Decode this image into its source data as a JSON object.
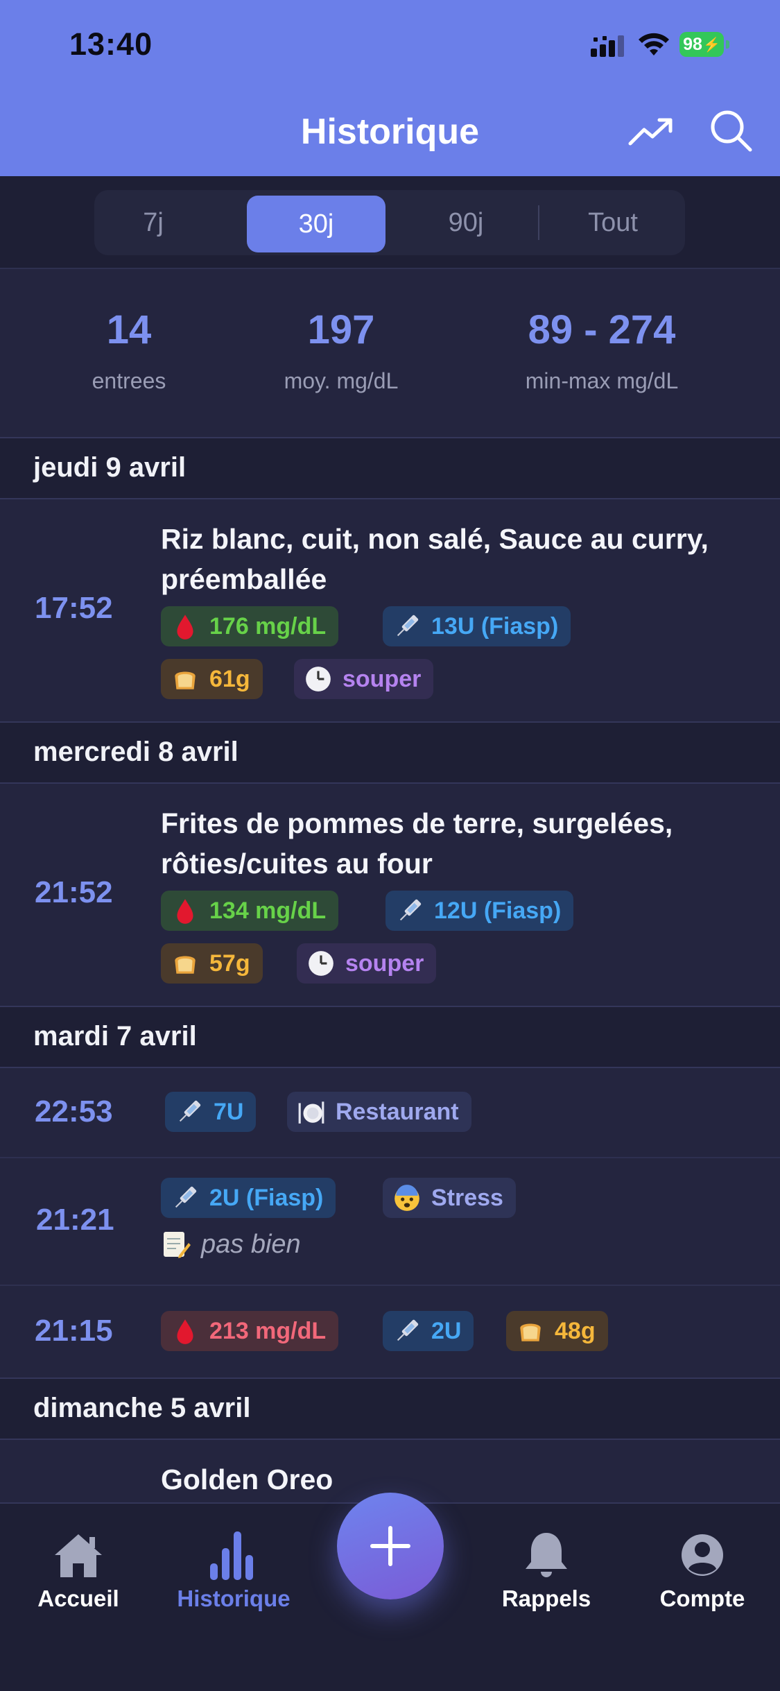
{
  "status_bar": {
    "time": "13:40",
    "battery": "98"
  },
  "header": {
    "title": "Historique"
  },
  "segments": [
    {
      "label": "7j",
      "active": false
    },
    {
      "label": "30j",
      "active": true
    },
    {
      "label": "90j",
      "active": false
    },
    {
      "label": "Tout",
      "active": false
    }
  ],
  "stats": [
    {
      "value": "14",
      "label": "entrees"
    },
    {
      "value": "197",
      "label": "moy. mg/dL"
    },
    {
      "value": "89 - 274",
      "label": "min-max mg/dL"
    }
  ],
  "days": [
    {
      "label": "jeudi 9 avril",
      "entries": [
        {
          "time": "17:52",
          "meal": "Riz blanc, cuit, non salé, Sauce au curry, préemballée",
          "chips": [
            {
              "type": "glucose",
              "text": "176 mg/dL",
              "icon": "blood-drop-icon"
            },
            {
              "type": "insulin",
              "text": "13U (Fiasp)",
              "icon": "syringe-icon"
            },
            {
              "type": "carbs",
              "text": "61g",
              "icon": "bread-icon"
            },
            {
              "type": "tag",
              "text": "souper",
              "icon": "clock-icon"
            }
          ]
        }
      ]
    },
    {
      "label": "mercredi 8 avril",
      "entries": [
        {
          "time": "21:52",
          "meal": "Frites de pommes de terre, surgelées, rôties/cuites au four",
          "chips": [
            {
              "type": "glucose",
              "text": "134 mg/dL",
              "icon": "blood-drop-icon"
            },
            {
              "type": "insulin",
              "text": "12U (Fiasp)",
              "icon": "syringe-icon"
            },
            {
              "type": "carbs",
              "text": "57g",
              "icon": "bread-icon"
            },
            {
              "type": "tag",
              "text": "souper",
              "icon": "clock-icon"
            }
          ]
        }
      ]
    },
    {
      "label": "mardi 7 avril",
      "entries": [
        {
          "time": "22:53",
          "chips": [
            {
              "type": "insulin",
              "text": "7U",
              "icon": "syringe-icon"
            },
            {
              "type": "tag",
              "text": "Restaurant",
              "icon": "plate-icon"
            }
          ]
        },
        {
          "time": "21:21",
          "chips": [
            {
              "type": "insulin",
              "text": "2U (Fiasp)",
              "icon": "syringe-icon"
            },
            {
              "type": "tag",
              "text": "Stress",
              "icon": "anxious-face-icon"
            }
          ],
          "note": "pas bien"
        },
        {
          "time": "21:15",
          "chips": [
            {
              "type": "glucose",
              "text": "213 mg/dL",
              "icon": "blood-drop-icon"
            },
            {
              "type": "insulin",
              "text": "2U",
              "icon": "syringe-icon"
            },
            {
              "type": "carbs",
              "text": "48g",
              "icon": "bread-icon"
            }
          ]
        }
      ]
    },
    {
      "label": "dimanche 5 avril",
      "entries": [
        {
          "meal": "Golden Oreo"
        }
      ]
    }
  ],
  "tabbar": [
    {
      "label": "Accueil",
      "icon": "home-icon",
      "active": false
    },
    {
      "label": "Historique",
      "icon": "bar-chart-icon",
      "active": true
    },
    {
      "label": "Rappels",
      "icon": "bell-icon",
      "active": false
    },
    {
      "label": "Compte",
      "icon": "user-circle-icon",
      "active": false
    }
  ],
  "colors": {
    "accent": "#6b7fe9",
    "background": "#24253f",
    "glucose_ok": "#67d249",
    "glucose_high": "#f2687a",
    "insulin": "#46a8f5",
    "carbs": "#f5b73b",
    "tag": "#b583ef"
  }
}
